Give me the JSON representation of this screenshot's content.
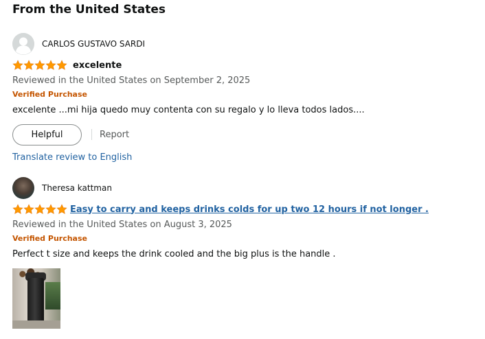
{
  "section": {
    "title": "From the United States"
  },
  "reviews": [
    {
      "reviewer": "CARLOS GUSTAVO SARDI",
      "rating": 5,
      "title": "excelente",
      "date": "Reviewed in the United States on September 2, 2025",
      "verified": "Verified Purchase",
      "body": "excelente ...mi hija quedo muy contenta con su regalo y lo lleva todos lados....",
      "helpful_label": "Helpful",
      "report_label": "Report",
      "translate_label": "Translate review to English"
    },
    {
      "reviewer": "Theresa kattman",
      "rating": 5,
      "title": "Easy to carry and keeps drinks colds for up two 12 hours if not longer .",
      "date": "Reviewed in the United States on August 3, 2025",
      "verified": "Verified Purchase",
      "body": "Perfect t size and keeps the drink cooled and the big plus is the handle ."
    }
  ],
  "colors": {
    "star": "#ff9900",
    "verified": "#c45500",
    "link": "#2162a1",
    "muted": "#565959"
  },
  "icons": {
    "star": "star-icon",
    "default_avatar": "person-icon"
  }
}
